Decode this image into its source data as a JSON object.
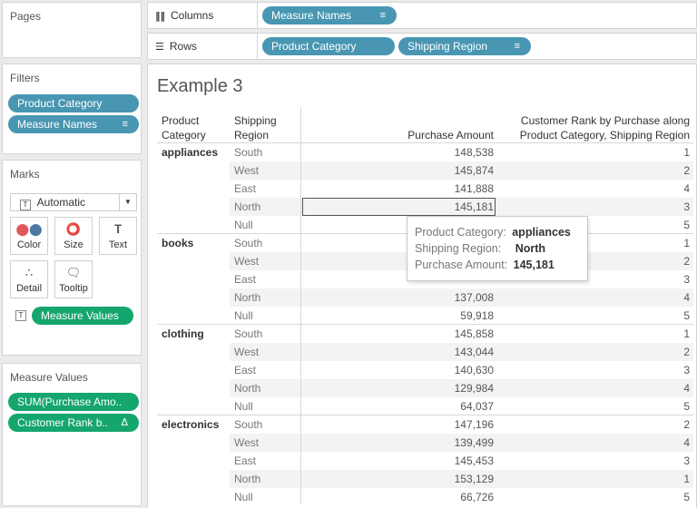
{
  "sidebar": {
    "pages_title": "Pages",
    "filters_title": "Filters",
    "filters": [
      "Product Category",
      "Measure Names"
    ],
    "marks_title": "Marks",
    "mark_type": "Automatic",
    "mark_buttons": [
      "Color",
      "Size",
      "Text",
      "Detail",
      "Tooltip"
    ],
    "marks_pill": "Measure Values",
    "measure_values_title": "Measure Values",
    "measure_pills": [
      "SUM(Purchase Amo..",
      "Customer Rank b.."
    ]
  },
  "shelves": {
    "columns_label": "Columns",
    "columns_pill": "Measure Names",
    "rows_label": "Rows",
    "rows_pills": [
      "Product Category",
      "Shipping Region"
    ]
  },
  "view": {
    "title": "Example 3",
    "headers": {
      "category": [
        "Product",
        "Category"
      ],
      "region": [
        "Shipping",
        "Region"
      ],
      "amount": "Purchase Amount",
      "rank": [
        "Customer Rank by Purchase along",
        "Product Category, Shipping Region"
      ]
    },
    "groups": [
      {
        "category": "appliances",
        "rows": [
          {
            "region": "South",
            "amount": "148,538",
            "rank": "1"
          },
          {
            "region": "West",
            "amount": "145,874",
            "rank": "2"
          },
          {
            "region": "East",
            "amount": "141,888",
            "rank": "4"
          },
          {
            "region": "North",
            "amount": "145,181",
            "rank": "3"
          },
          {
            "region": "Null",
            "amount": "",
            "rank": "5"
          }
        ]
      },
      {
        "category": "books",
        "rows": [
          {
            "region": "South",
            "amount": "",
            "rank": "1"
          },
          {
            "region": "West",
            "amount": "",
            "rank": "2"
          },
          {
            "region": "East",
            "amount": "",
            "rank": "3"
          },
          {
            "region": "North",
            "amount": "137,008",
            "rank": "4"
          },
          {
            "region": "Null",
            "amount": "59,918",
            "rank": "5"
          }
        ]
      },
      {
        "category": "clothing",
        "rows": [
          {
            "region": "South",
            "amount": "145,858",
            "rank": "1"
          },
          {
            "region": "West",
            "amount": "143,044",
            "rank": "2"
          },
          {
            "region": "East",
            "amount": "140,630",
            "rank": "3"
          },
          {
            "region": "North",
            "amount": "129,984",
            "rank": "4"
          },
          {
            "region": "Null",
            "amount": "64,037",
            "rank": "5"
          }
        ]
      },
      {
        "category": "electronics",
        "rows": [
          {
            "region": "South",
            "amount": "147,196",
            "rank": "2"
          },
          {
            "region": "West",
            "amount": "139,499",
            "rank": "4"
          },
          {
            "region": "East",
            "amount": "145,453",
            "rank": "3"
          },
          {
            "region": "North",
            "amount": "153,129",
            "rank": "1"
          },
          {
            "region": "Null",
            "amount": "66,726",
            "rank": "5"
          }
        ]
      }
    ],
    "tooltip": {
      "rows": [
        {
          "key": "Product Category:",
          "value": "appliances"
        },
        {
          "key": "Shipping Region:",
          "value": "North"
        },
        {
          "key": "Purchase Amount:",
          "value": "145,181"
        }
      ]
    }
  }
}
